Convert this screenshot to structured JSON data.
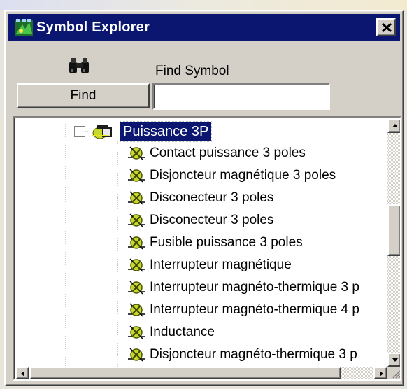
{
  "window": {
    "title": "Symbol Explorer",
    "close_icon": "close-icon",
    "app_icon": "symbol-explorer-app-icon"
  },
  "search": {
    "binoculars_icon": "binoculars-icon",
    "label": "Find Symbol",
    "button_label": "Find",
    "input_value": "",
    "input_placeholder": ""
  },
  "tree": {
    "parent": {
      "label": "Puissance 3P",
      "expanded": true,
      "selected": true,
      "icon": "folder-symbol-icon"
    },
    "items": [
      {
        "label": "Contact puissance 3 poles"
      },
      {
        "label": "Disjoncteur magnétique 3 poles"
      },
      {
        "label": "Disconecteur 3 poles"
      },
      {
        "label": "Disconecteur 3 poles"
      },
      {
        "label": "Fusible puissance 3 poles"
      },
      {
        "label": "Interrupteur magnétique"
      },
      {
        "label": "Interrupteur magnéto-thermique 3 p"
      },
      {
        "label": "Interrupteur magnéto-thermique 4 p"
      },
      {
        "label": "Inductance"
      },
      {
        "label": "Disjoncteur magnéto-thermique 3 p"
      }
    ]
  },
  "colors": {
    "titlebar": "#0b1670",
    "face": "#d4d0c8",
    "selection": "#0b1670",
    "item_icon_green": "#c8d82a"
  }
}
